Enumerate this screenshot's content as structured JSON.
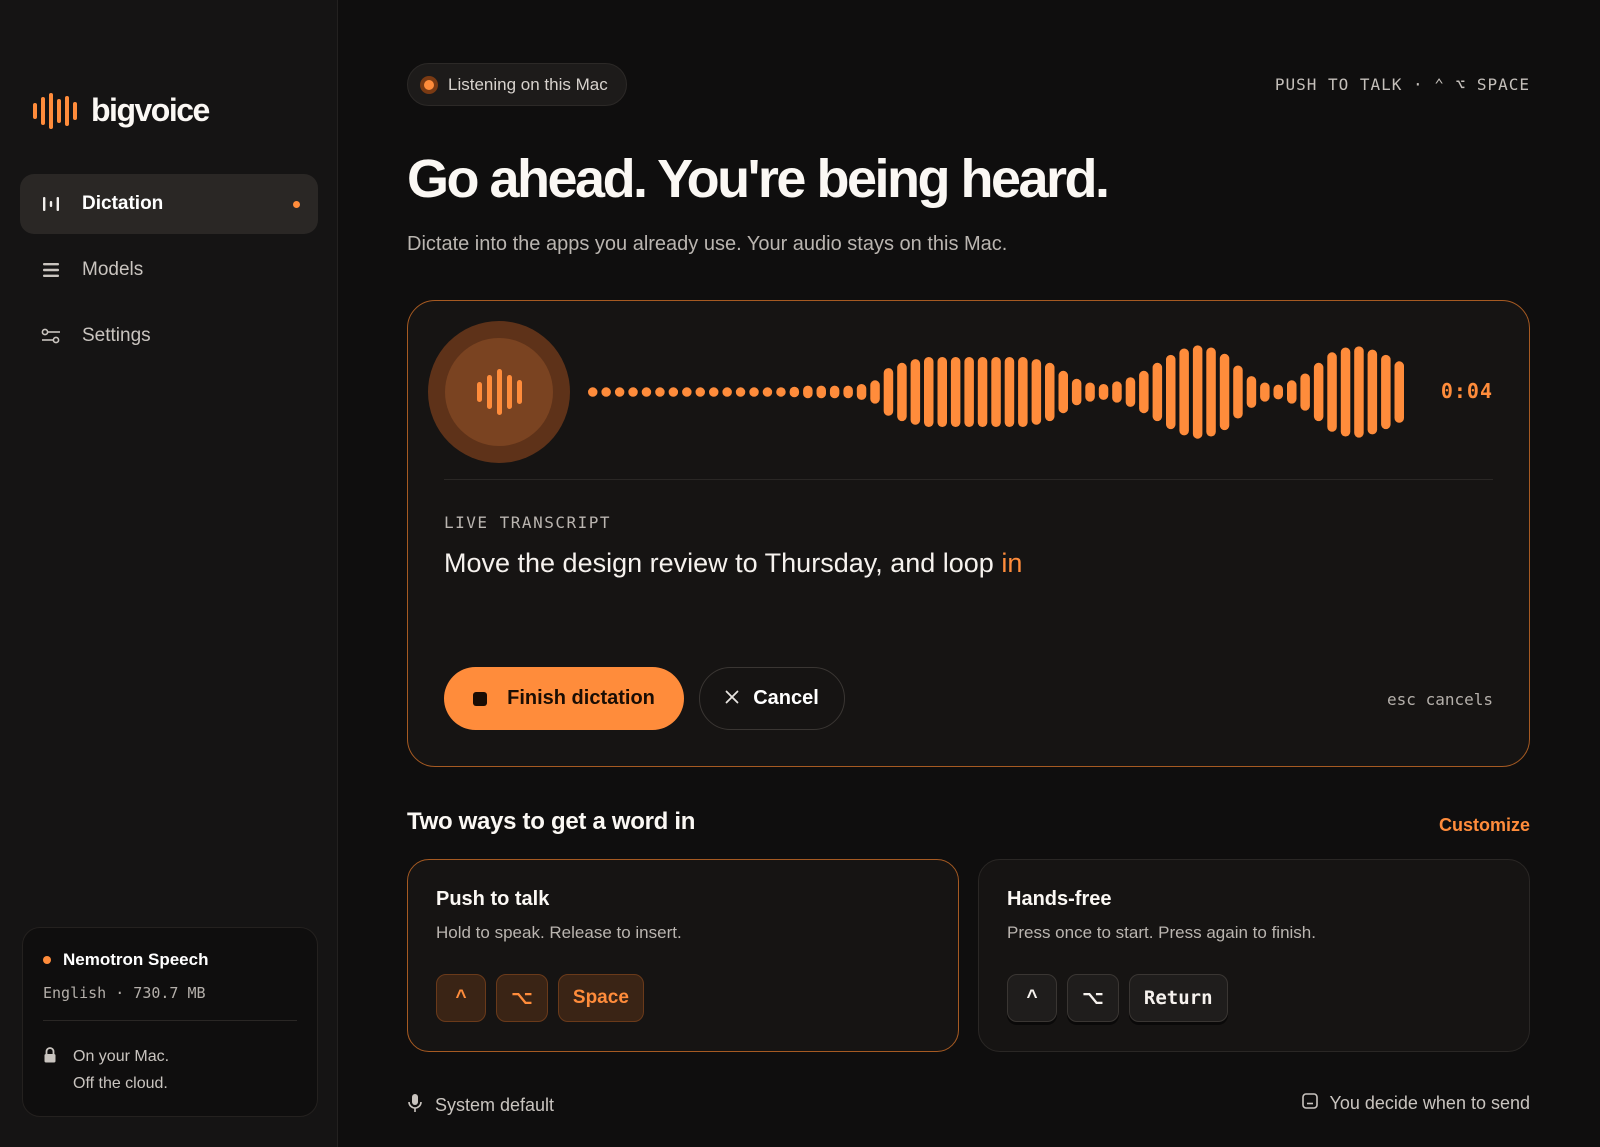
{
  "app": {
    "name": "bigvoice",
    "accent_color": "#ff8c3b"
  },
  "sidebar": {
    "items": [
      {
        "label": "Dictation",
        "icon": "waveform-icon",
        "active": true
      },
      {
        "label": "Models",
        "icon": "list-icon",
        "active": false
      },
      {
        "label": "Settings",
        "icon": "sliders-icon",
        "active": false
      }
    ],
    "model": {
      "name": "Nemotron Speech",
      "meta": "English · 730.7 MB",
      "privacy_line1": "On your Mac.",
      "privacy_line2": "Off the cloud."
    }
  },
  "header": {
    "status": "Listening on this Mac",
    "push_to_talk_hint": "PUSH TO TALK · ⌃ ⌥ SPACE",
    "title": "Go ahead. You're being heard.",
    "subtitle": "Dictate into the apps you already use. Your audio stays on this Mac."
  },
  "dictation": {
    "timer": "0:04",
    "transcript_label": "LIVE TRANSCRIPT",
    "transcript_text": "Move the design review to Thursday, and loop ",
    "transcript_live_word": "in",
    "finish_label": "Finish dictation",
    "cancel_label": "Cancel",
    "esc_hint": "esc cancels",
    "waveform_levels": [
      0.08,
      0.08,
      0.08,
      0.08,
      0.08,
      0.08,
      0.08,
      0.08,
      0.08,
      0.08,
      0.08,
      0.08,
      0.08,
      0.08,
      0.09,
      0.1,
      0.12,
      0.12,
      0.12,
      0.12,
      0.15,
      0.22,
      0.45,
      0.55,
      0.62,
      0.66,
      0.66,
      0.66,
      0.66,
      0.66,
      0.66,
      0.66,
      0.66,
      0.62,
      0.55,
      0.4,
      0.25,
      0.18,
      0.15,
      0.2,
      0.28,
      0.4,
      0.55,
      0.7,
      0.82,
      0.88,
      0.84,
      0.72,
      0.5,
      0.3,
      0.18,
      0.14,
      0.22,
      0.35,
      0.55,
      0.75,
      0.84,
      0.86,
      0.8,
      0.7,
      0.58
    ],
    "waveform_color": "#ff8c3b"
  },
  "modes": {
    "section_title": "Two ways to get a word in",
    "customize_label": "Customize",
    "push_to_talk": {
      "title": "Push to talk",
      "description": "Hold to speak. Release to insert.",
      "keys": [
        "^",
        "⌥",
        "Space"
      ]
    },
    "hands_free": {
      "title": "Hands-free",
      "description": "Press once to start. Press again to finish.",
      "keys": [
        "^",
        "⌥",
        "Return"
      ]
    }
  },
  "footer": {
    "input_device": "System default",
    "send_mode": "You decide when to send"
  }
}
